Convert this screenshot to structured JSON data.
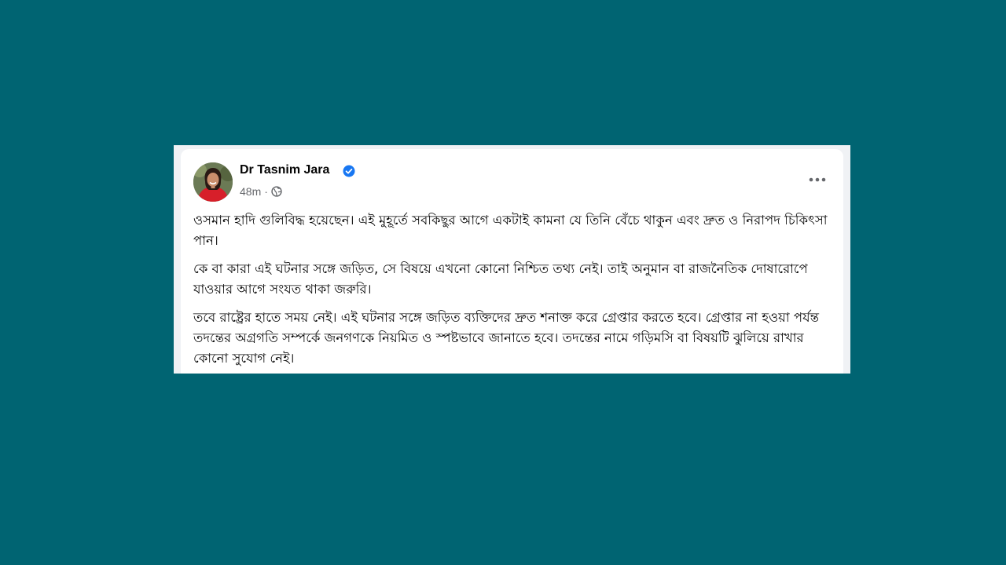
{
  "post": {
    "author": "Dr Tasnim Jara",
    "verified": true,
    "time": "48m",
    "separator": "·",
    "audience_icon": "globe-icon",
    "more_icon": "more-options-icon",
    "paragraphs": [
      "ওসমান হাদি গুলিবিদ্ধ হয়েছেন। এই মুহূর্তে সবকিছুর আগে একটাই কামনা যে তিনি বেঁচে থাকুন এবং দ্রুত ও নিরাপদ চিকিৎসা পান।",
      "কে বা কারা এই ঘটনার সঙ্গে জড়িত, সে বিষয়ে এখনো কোনো নিশ্চিত তথ্য নেই। তাই অনুমান বা রাজনৈতিক দোষারোপে যাওয়ার আগে সংযত থাকা জরুরি।",
      "তবে রাষ্ট্রের হাতে সময় নেই। এই ঘটনার সঙ্গে জড়িত ব্যক্তিদের দ্রুত শনাক্ত করে গ্রেপ্তার করতে হবে। গ্রেপ্তার না হওয়া পর্যন্ত তদন্তের অগ্রগতি সম্পর্কে জনগণকে নিয়মিত ও স্পষ্টভাবে জানাতে হবে। তদন্তের নামে গড়িমসি বা বিষয়টি ঝুলিয়ে রাখার কোনো সুযোগ নেই।"
    ]
  },
  "colors": {
    "background": "#006472",
    "card": "#ffffff",
    "text": "#050505",
    "secondary_text": "#65676b",
    "verified_badge": "#1877f2"
  }
}
